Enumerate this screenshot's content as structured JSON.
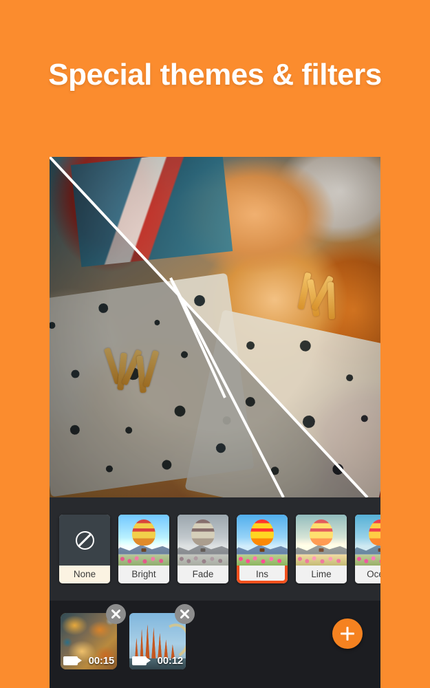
{
  "headline": "Special themes & filters",
  "colors": {
    "background_orange": "#FB8C2E",
    "panel_dark": "#282A2E",
    "timeline_dark": "#1C1D21",
    "filter_selected_border": "#F4511E",
    "clip_selected_border": "#F5A623",
    "fab_orange": "#F58220"
  },
  "preview": {
    "name": "video-preview",
    "split_compare": true,
    "description": "Overhead photo of burgers and fries on patterned wrapping paper with a diagonal filter-compare split"
  },
  "filters": {
    "strip_name": "filter-strip",
    "selected": "Ins",
    "items": [
      {
        "label": "None",
        "icon": "no-filter-icon",
        "variant": "none",
        "selected": false
      },
      {
        "label": "Bright",
        "icon": "balloon-thumb",
        "variant": "bright",
        "selected": false
      },
      {
        "label": "Fade",
        "icon": "balloon-thumb",
        "variant": "fade",
        "selected": false
      },
      {
        "label": "Ins",
        "icon": "balloon-thumb",
        "variant": "ins",
        "selected": true
      },
      {
        "label": "Lime",
        "icon": "balloon-thumb",
        "variant": "lime",
        "selected": false
      },
      {
        "label": "Ocean",
        "icon": "balloon-thumb",
        "variant": "ocean",
        "selected": false
      }
    ]
  },
  "timeline": {
    "clips": [
      {
        "duration": "00:15",
        "thumb": "food-collage-thumb",
        "selected": true,
        "close_icon": "close-icon",
        "media_icon": "video-camera-icon"
      },
      {
        "duration": "00:12",
        "thumb": "sagrada-familia-thumb",
        "selected": false,
        "close_icon": "close-icon",
        "media_icon": "video-camera-icon"
      }
    ],
    "add_button": {
      "name": "add-clip-button",
      "icon": "plus-icon"
    }
  }
}
